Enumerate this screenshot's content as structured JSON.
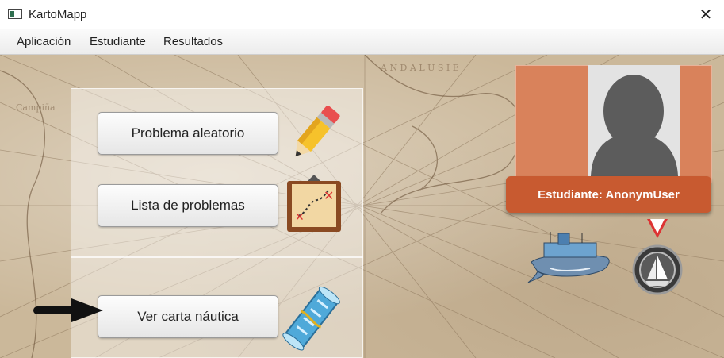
{
  "window": {
    "title": "KartoMapp"
  },
  "menu": {
    "items": [
      "Aplicación",
      "Estudiante",
      "Resultados"
    ]
  },
  "actions": {
    "random_problem": "Problema aleatorio",
    "problem_list": "Lista de problemas",
    "nautical_chart": "Ver carta náutica"
  },
  "student": {
    "label": "Estudiante: AnonymUser"
  },
  "colors": {
    "accent": "#c85a30",
    "card": "#d9825b",
    "map": "#cbb89a"
  },
  "icons": [
    "pencil-icon",
    "treasure-map-icon",
    "scroll-icon",
    "ship-whale-icon",
    "medal-icon",
    "arrow-icon",
    "close-icon"
  ]
}
